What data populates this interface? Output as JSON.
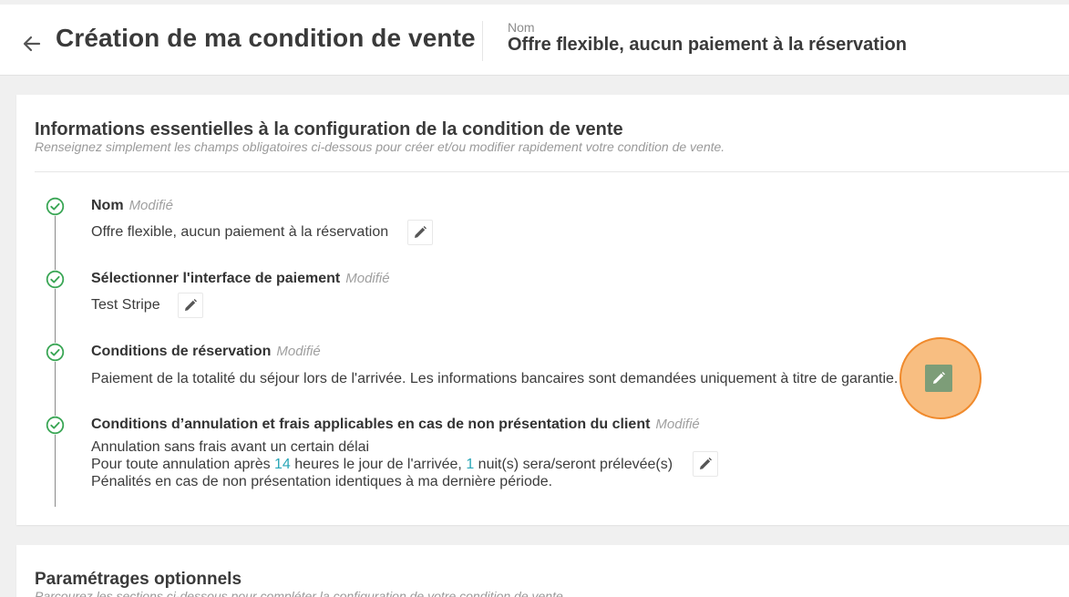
{
  "header": {
    "title": "Création de ma condition de vente",
    "name_label": "Nom",
    "name_value": "Offre flexible, aucun paiement à la réservation"
  },
  "essentials": {
    "title": "Informations essentielles à la configuration de la condition de vente",
    "subtitle": "Renseignez simplement les champs obligatoires ci-dessous pour créer et/ou modifier rapidement votre condition de vente.",
    "steps": [
      {
        "title": "Nom",
        "status": "Modifié",
        "text": "Offre flexible, aucun paiement à la réservation"
      },
      {
        "title": "Sélectionner l'interface de paiement",
        "status": "Modifié",
        "text": "Test Stripe"
      },
      {
        "title": "Conditions de réservation",
        "status": "Modifié",
        "text": "Paiement de la totalité du séjour lors de l'arrivée. Les informations bancaires sont demandées uniquement à titre de garantie."
      },
      {
        "title": "Conditions d’annulation et frais applicables en cas de non présentation du client",
        "status": "Modifié",
        "line1": "Annulation sans frais avant un certain délai",
        "line2_a": "Pour toute annulation après ",
        "line2_hours": "14",
        "line2_b": " heures le jour de l'arrivée, ",
        "line2_nights": "1",
        "line2_c": " nuit(s) sera/seront prélevée(s)",
        "line3": "Pénalités en cas de non présentation identiques à ma dernière période."
      }
    ]
  },
  "optional": {
    "title": "Paramétrages optionnels",
    "subtitle": "Parcourez les sections ci-dessous pour compléter la configuration de votre condition de vente."
  },
  "icons": {
    "back": "arrow-left-icon",
    "step_done": "check-circle-icon",
    "edit": "pencil-icon"
  },
  "colors": {
    "accent_green": "#3aa655",
    "highlight_orange": "#f08a2c",
    "number_teal": "#2aa7b8"
  }
}
